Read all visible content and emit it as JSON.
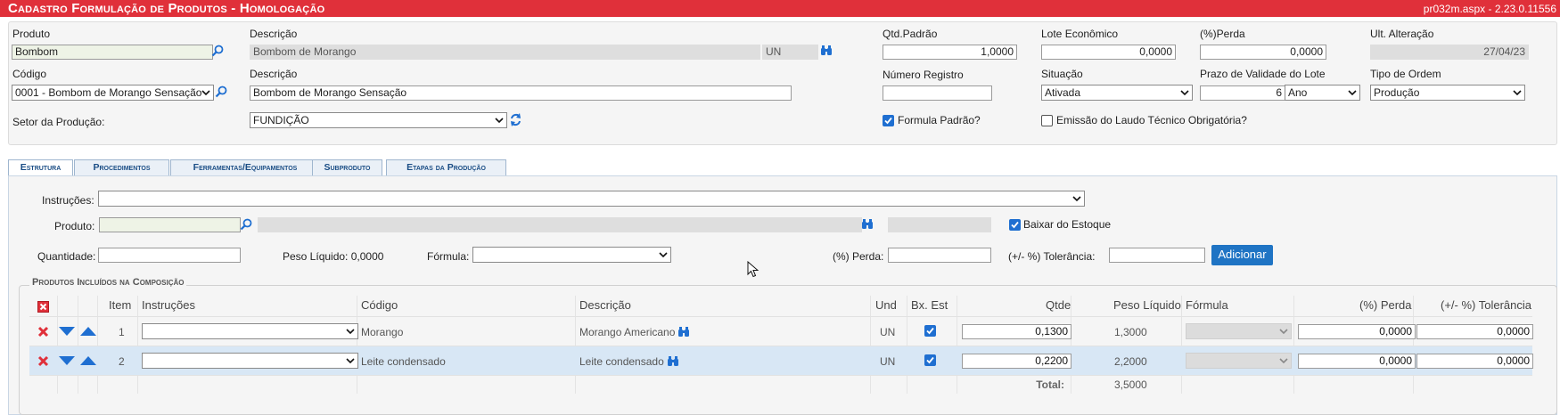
{
  "titlebar": {
    "title": "Cadastro Formulação de Produtos  - Homologação",
    "version": "pr032m.aspx - 2.23.0.11556"
  },
  "header": {
    "produto_label": "Produto",
    "produto_value": "Bombom",
    "descricao_label": "Descrição",
    "descricao_value": "Bombom de Morango",
    "unit_value": "UN",
    "qtd_label": "Qtd.Padrão",
    "qtd_value": "1,0000",
    "lote_label": "Lote Econômico",
    "lote_value": "0,0000",
    "perda_label": "(%)Perda",
    "perda_value": "0,0000",
    "ult_label": "Ult. Alteração",
    "ult_value": "27/04/23",
    "codigo_label": "Código",
    "codigo_value": "0001 - Bombom de Morango Sensação",
    "descricao2_label": "Descrição",
    "descricao2_value": "Bombom de Morango Sensação",
    "numreg_label": "Número Registro",
    "numreg_value": "",
    "situacao_label": "Situação",
    "situacao_value": "Ativada",
    "prazo_label": "Prazo de Validade do Lote",
    "prazo_value": "6",
    "prazo_unit": "Ano",
    "tipo_label": "Tipo de Ordem",
    "tipo_value": "Produção",
    "setor_label": "Setor da Produção:",
    "setor_value": "FUNDIÇÃO",
    "formula_padrao_label": "Formula Padrão?",
    "formula_padrao_checked": true,
    "laudo_label": "Emissão do Laudo Técnico Obrigatória?",
    "laudo_checked": false
  },
  "tabs": [
    {
      "label": "Estrutura",
      "active": true
    },
    {
      "label": "Procedimentos",
      "active": false
    },
    {
      "label": "Ferramentas/Equipamentos",
      "active": false
    },
    {
      "label": "Subproduto",
      "active": false
    },
    {
      "label": "Etapas da Produção",
      "active": false
    }
  ],
  "estrutura": {
    "instrucoes_label": "Instruções:",
    "produto_label": "Produto:",
    "baixar_label": "Baixar do Estoque",
    "quantidade_label": "Quantidade:",
    "peso_label": "Peso Líquido: 0,0000",
    "formula_label": "Fórmula:",
    "perda_label": "(%) Perda:",
    "tolerancia_label": "(+/- %) Tolerância:",
    "adicionar_label": "Adicionar",
    "fieldset_legend": "Produtos Incluídos na Composição"
  },
  "grid": {
    "headers": {
      "item": "Item",
      "instrucoes": "Instruções",
      "codigo": "Código",
      "descricao": "Descrição",
      "und": "Und",
      "bxest": "Bx. Est",
      "qtde": "Qtde",
      "peso": "Peso Líquido",
      "formula": "Fórmula",
      "perda": "(%) Perda",
      "tolerancia": "(+/- %) Tolerância"
    },
    "rows": [
      {
        "item": "1",
        "codigo": "Morango",
        "descricao": "Morango Americano",
        "und": "UN",
        "qtde": "0,1300",
        "peso": "1,3000",
        "perda": "0,0000",
        "tolerancia": "0,0000"
      },
      {
        "item": "2",
        "codigo": "Leite condensado",
        "descricao": "Leite condensado",
        "und": "UN",
        "qtde": "0,2200",
        "peso": "2,2000",
        "perda": "0,0000",
        "tolerancia": "0,0000"
      }
    ],
    "total_label": "Total:",
    "total_value": "3,5000"
  },
  "colors": {
    "titlebar": "#e0303a",
    "accent": "#1f74c4",
    "selected_row": "#d8e7f5"
  }
}
